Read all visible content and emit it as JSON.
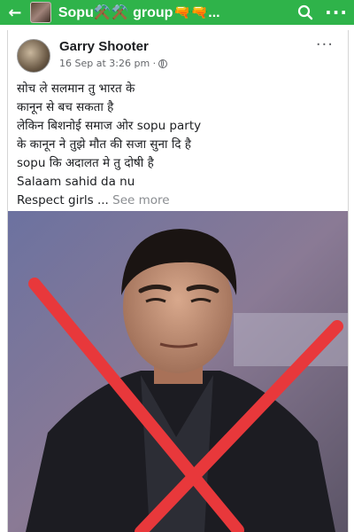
{
  "topbar": {
    "back_icon": "arrow-left-icon",
    "title": "Sopu⚒️⚒️ group🔫🔫...",
    "search_icon": "search-icon",
    "more_label": "···"
  },
  "post": {
    "author": "Garry Shooter",
    "timestamp": "16 Sep at 3:26 pm ·",
    "privacy_icon": "globe-icon",
    "more_label": "···",
    "lines": [
      "सोच ले सलमान तु भारत के",
      "कानून से बच सकता है",
      "लेकिन बिशनोई समाज ओर sopu party",
      "के कानून ने तुझे मौत की सजा सुना दि है",
      "sopu कि अदालत मे तु दोषी है",
      "Salaam sahid da nu",
      "Respect girls ..."
    ],
    "see_more": "See more"
  },
  "colors": {
    "topbar_green": "#2fb34a",
    "cross_red": "#e8383b"
  }
}
